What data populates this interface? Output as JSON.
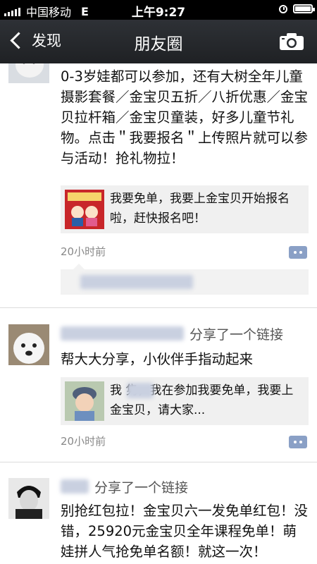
{
  "status_bar": {
    "carrier": "中国移动",
    "network": "E",
    "time": "上午9:27"
  },
  "nav": {
    "back_label": "发现",
    "title": "朋友圈"
  },
  "posts": [
    {
      "text": "0-3岁娃都可以参加，还有大树全年儿童摄影套餐／金宝贝五折／八折优惠／金宝贝拉杆箱／金宝贝童装，好多儿童节礼物。点击＂我要报名＂上传照片就可以参与活动！抢礼物拉！",
      "link_text": "我要免单，我要上金宝贝开始报名啦，赶快报名吧！",
      "timestamp": "20小时前"
    },
    {
      "share_label": "分享了一个链接",
      "text": "帮大大分享，小伙伴手指动起来",
      "link_text": "我       隽，我在参加我要免单，我要上金宝贝，请大家...",
      "timestamp": "20小时前"
    },
    {
      "share_label": "分享了一个链接",
      "text": "别抢红包拉！金宝贝六一发免单红包！没错，25920元金宝贝全年课程免单！萌娃拼人气抢免单名额！就这一次！"
    }
  ],
  "icons": {
    "back": "chevron-left-icon",
    "camera": "camera-icon",
    "comment": "comment-icon",
    "clock": "clock-icon",
    "battery": "battery-icon"
  },
  "colors": {
    "navbar": "#26292d",
    "timestamp": "#888888",
    "comment_button": "#8aa0c6",
    "link_card_bg": "#f0f0f0"
  }
}
